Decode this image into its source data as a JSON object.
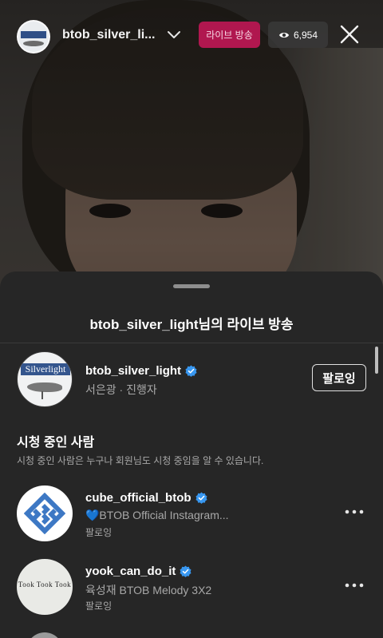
{
  "topbar": {
    "host_name": "btob_silver_li...",
    "live_label": "라이브 방송",
    "viewer_count": "6,954"
  },
  "sheet": {
    "title": "btob_silver_light님의 라이브 방송",
    "host": {
      "username": "btob_silver_light",
      "subtitle": "서은광 · 진행자",
      "follow_label": "팔로잉",
      "avatar_text": "Silverlight"
    },
    "section_title": "시청 중인 사람",
    "section_desc": "시청 중인 사람은 누구나 회원님도 시청 중임을 알 수 있습니다.",
    "viewers": [
      {
        "username": "cube_official_btob",
        "bio": "💙BTOB Official Instagram...",
        "status": "팔로잉",
        "verified": true
      },
      {
        "username": "yook_can_do_it",
        "bio": "육성재 BTOB Melody 3X2",
        "status": "팔로잉",
        "verified": true,
        "avatar_text": "Took Took Took"
      }
    ]
  },
  "colors": {
    "live_badge": "#b0174f",
    "verified": "#3897f0",
    "sheet_bg": "#262626",
    "cube_blue": "#3d78c4"
  },
  "icons": [
    "chevron-down-icon",
    "eye-icon",
    "close-icon",
    "verified-icon",
    "more-icon"
  ]
}
